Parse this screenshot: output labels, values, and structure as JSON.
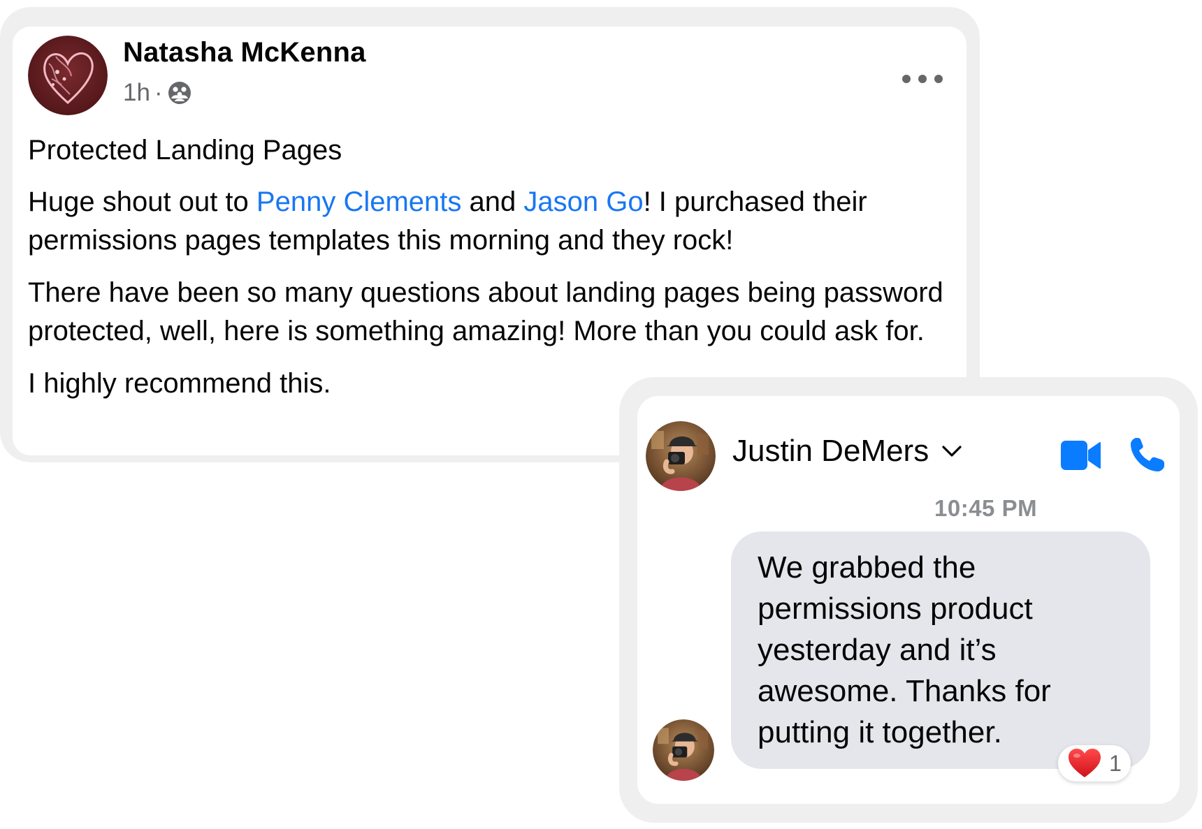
{
  "post": {
    "author": "Natasha McKenna",
    "time": "1h",
    "separator": "·",
    "audience_icon": "group-audience-icon",
    "more_icon": "more-options-icon",
    "title": "Protected Landing Pages",
    "p1_before": "Huge shout out to ",
    "mention1": "Penny Clements",
    "p1_mid": " and ",
    "mention2": "Jason Go",
    "p1_after": "! I purchased their permissions pages templates this morning and they rock!",
    "p2": "There have been so many questions about landing pages being password protected, well, here is something amazing! More than you could ask for.",
    "p3": "I highly recommend this.",
    "mention_color": "#1877f2"
  },
  "messenger": {
    "contact_name": "Justin DeMers",
    "timestamp": "10:45 PM",
    "message": "We grabbed the permissions product yesterday and it’s awesome. Thanks for putting it together.",
    "reaction_icon": "heart-icon",
    "reaction_count": "1",
    "accent_color": "#0a7cff",
    "bubble_color": "#e4e6eb"
  }
}
